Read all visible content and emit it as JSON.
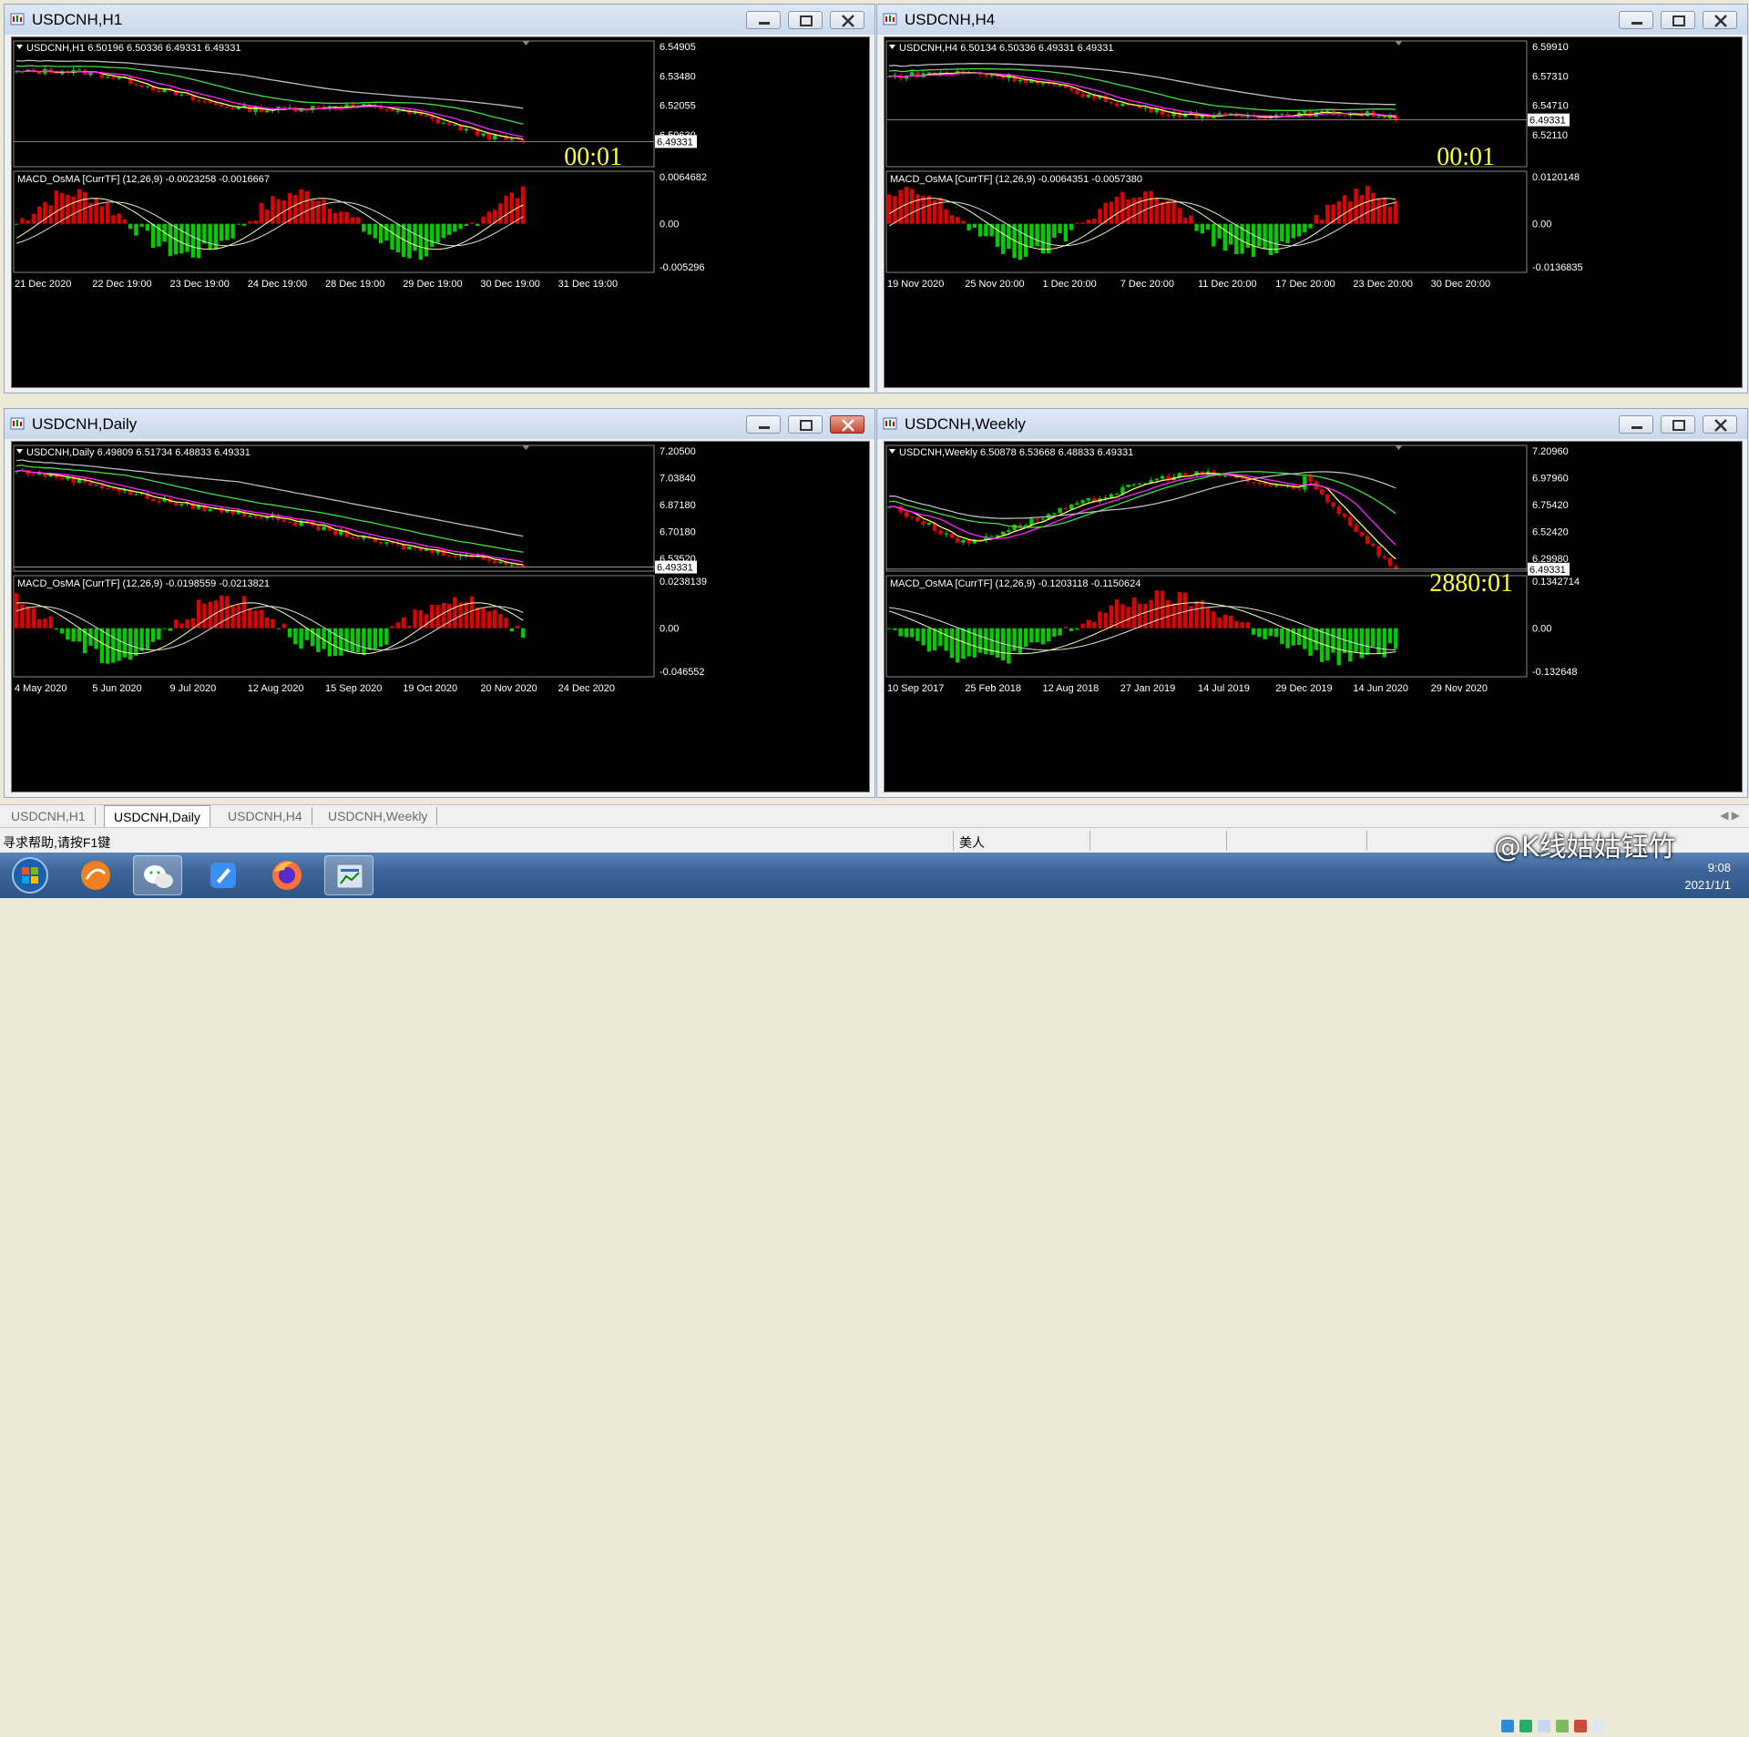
{
  "windows": [
    {
      "id": "h1",
      "title": "USDCNH,H1",
      "header": "USDCNH,H1  6.50196 6.50336 6.49331 6.49331",
      "price_ticks": [
        "6.54905",
        "6.53480",
        "6.52055",
        "6.50630"
      ],
      "current_price": "6.49331",
      "countdown": "00:01",
      "macd_label": "MACD_OsMA [CurrTF] (12,26,9) -0.0023258 -0.0016667",
      "macd_ticks": [
        "0.0064682",
        "0.00",
        "-0.005296"
      ],
      "time_labels": [
        "21 Dec 2020",
        "22 Dec 19:00",
        "23 Dec 19:00",
        "24 Dec 19:00",
        "28 Dec 19:00",
        "29 Dec 19:00",
        "30 Dec 19:00",
        "31 Dec 19:00"
      ],
      "close_red": false
    },
    {
      "id": "h4",
      "title": "USDCNH,H4",
      "header": "USDCNH,H4  6.50134 6.50336 6.49331 6.49331",
      "price_ticks": [
        "6.59910",
        "6.57310",
        "6.54710",
        "6.52110"
      ],
      "current_price": "6.49331",
      "countdown": "00:01",
      "macd_label": "MACD_OsMA [CurrTF] (12,26,9) -0.0064351 -0.0057380",
      "macd_ticks": [
        "0.0120148",
        "0.00",
        "-0.0136835"
      ],
      "time_labels": [
        "19 Nov 2020",
        "25 Nov 20:00",
        "1 Dec 20:00",
        "7 Dec 20:00",
        "11 Dec 20:00",
        "17 Dec 20:00",
        "23 Dec 20:00",
        "30 Dec 20:00"
      ],
      "close_red": false
    },
    {
      "id": "daily",
      "title": "USDCNH,Daily",
      "header": "USDCNH,Daily  6.49809 6.51734 6.48833 6.49331",
      "price_ticks": [
        "7.20500",
        "7.03840",
        "6.87180",
        "6.70180",
        "6.53520"
      ],
      "current_price": "6.49331",
      "countdown": "",
      "macd_label": "MACD_OsMA [CurrTF] (12,26,9) -0.0198559 -0.0213821",
      "macd_ticks": [
        "0.0238139",
        "0.00",
        "-0.046552"
      ],
      "time_labels": [
        "4 May 2020",
        "5 Jun 2020",
        "9 Jul 2020",
        "12 Aug 2020",
        "15 Sep 2020",
        "19 Oct 2020",
        "20 Nov 2020",
        "24 Dec 2020"
      ],
      "close_red": true
    },
    {
      "id": "weekly",
      "title": "USDCNH,Weekly",
      "header": "USDCNH,Weekly  6.50878 6.53668 6.48833 6.49331",
      "price_ticks": [
        "7.20960",
        "6.97960",
        "6.75420",
        "6.52420",
        "6.29980"
      ],
      "current_price": "6.49331",
      "countdown": "2880:01",
      "macd_label": "MACD_OsMA [CurrTF] (12,26,9) -0.1203118 -0.1150624",
      "macd_ticks": [
        "0.1342714",
        "0.00",
        "-0.132648"
      ],
      "time_labels": [
        "10 Sep 2017",
        "25 Feb 2018",
        "12 Aug 2018",
        "27 Jan 2019",
        "14 Jul 2019",
        "29 Dec 2019",
        "14 Jun 2020",
        "29 Nov 2020"
      ],
      "close_red": false
    }
  ],
  "tabs": [
    {
      "label": "USDCNH,H1",
      "active": false
    },
    {
      "label": "USDCNH,Daily",
      "active": true
    },
    {
      "label": "USDCNH,H4",
      "active": false
    },
    {
      "label": "USDCNH,Weekly",
      "active": false
    }
  ],
  "tab_arrows": "◀ ▶",
  "status": {
    "help": "寻求帮助,请按F1键",
    "timezone": "美人"
  },
  "watermark": "@K线姑姑钰竹",
  "clock": {
    "time": "9:08",
    "date": "2021/1/1"
  },
  "taskbar_apps": [
    "start-orb-icon",
    "app-icon",
    "wechat-icon",
    "feishu-icon",
    "firefox-icon",
    "metatrader-icon"
  ],
  "colors": {
    "chart_bg": "#000000",
    "bull": "#00cc00",
    "bear": "#e00000",
    "ma_yellow": "#ffff66",
    "ma_magenta": "#ff22ff",
    "ma_green": "#44dd44",
    "ma_gray": "#bbbbbb",
    "countdown": "#ffff33"
  }
}
